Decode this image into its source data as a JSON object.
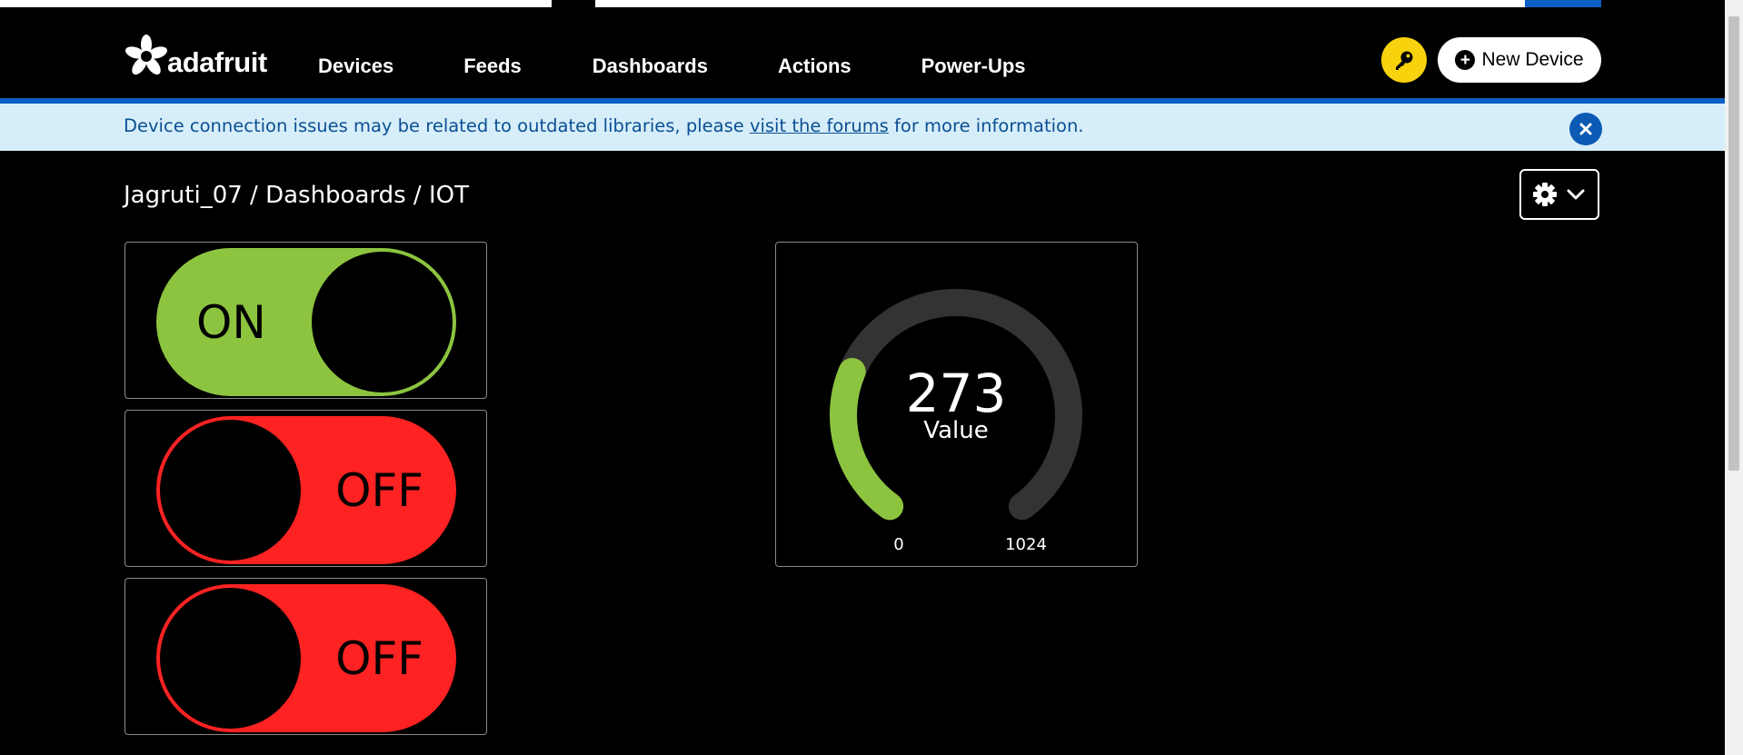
{
  "header": {
    "logo_text": "adafruit",
    "nav": [
      "Devices",
      "Feeds",
      "Dashboards",
      "Actions",
      "Power-Ups"
    ],
    "new_device_label": "New Device",
    "key_icon": "key-icon"
  },
  "banner": {
    "text_before": "Device connection issues may be related to outdated libraries, please ",
    "link_text": "visit the forums",
    "text_after": " for more information."
  },
  "breadcrumb": "Jagruti_07 / Dashboards / IOT",
  "toggles": [
    {
      "label": "ON",
      "state": "on"
    },
    {
      "label": "OFF",
      "state": "off"
    },
    {
      "label": "OFF",
      "state": "off"
    }
  ],
  "gauge": {
    "value": 273,
    "value_text": "273",
    "label": "Value",
    "min": 0,
    "max": 1024,
    "min_text": "0",
    "max_text": "1024",
    "fill_color": "#8cc43f",
    "track_color": "#333333"
  },
  "colors": {
    "on": "#8cc43f",
    "off": "#ff2222",
    "banner_bg": "#d6eef9",
    "accent_blue": "#0c5fc4",
    "key_yellow": "#f8d20d"
  }
}
